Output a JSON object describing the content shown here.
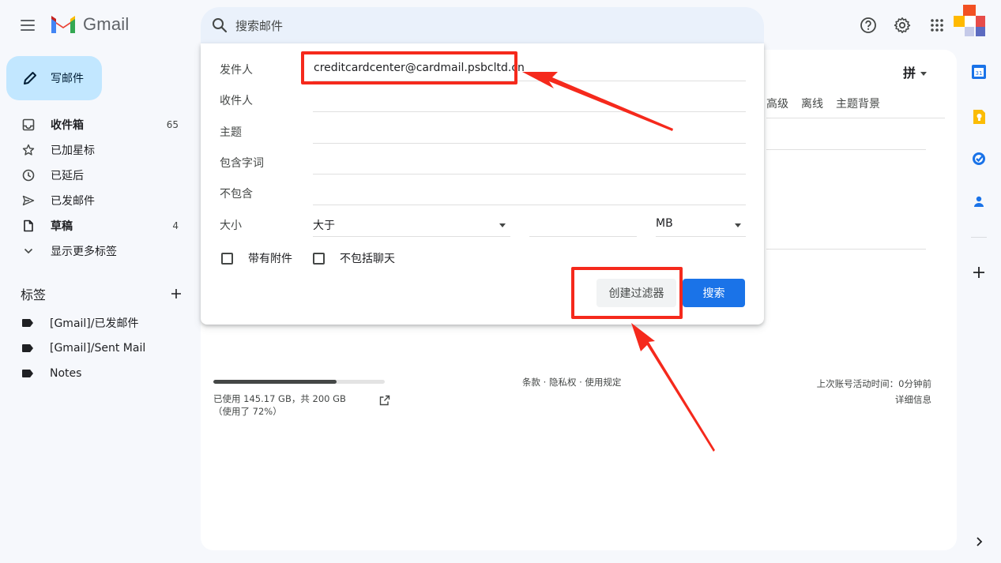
{
  "app": {
    "name": "Gmail",
    "search_placeholder": "搜索邮件"
  },
  "compose": {
    "label": "写邮件"
  },
  "nav": [
    {
      "name": "inbox",
      "label": "收件箱",
      "count": "65",
      "bold": true,
      "icon": "inbox-icon"
    },
    {
      "name": "starred",
      "label": "已加星标",
      "count": "",
      "bold": false,
      "icon": "star-icon"
    },
    {
      "name": "snoozed",
      "label": "已延后",
      "count": "",
      "bold": false,
      "icon": "clock-icon"
    },
    {
      "name": "sent",
      "label": "已发邮件",
      "count": "",
      "bold": false,
      "icon": "send-icon"
    },
    {
      "name": "drafts",
      "label": "草稿",
      "count": "4",
      "bold": true,
      "icon": "file-icon"
    },
    {
      "name": "more",
      "label": "显示更多标签",
      "count": "",
      "bold": false,
      "icon": "chevron-down-icon"
    }
  ],
  "labels": {
    "title": "标签",
    "items": [
      "[Gmail]/已发邮件",
      "[Gmail]/Sent Mail",
      "Notes"
    ]
  },
  "search_options": {
    "from_label": "发件人",
    "from_value": "creditcardcenter@cardmail.psbcltd.cn",
    "to_label": "收件人",
    "to_value": "",
    "subject_label": "主题",
    "subject_value": "",
    "has_words_label": "包含字词",
    "has_words_value": "",
    "no_words_label": "不包含",
    "no_words_value": "",
    "size_label": "大小",
    "size_operator": "大于",
    "size_value": "",
    "size_unit": "MB",
    "has_attachment_label": "带有附件",
    "exclude_chats_label": "不包括聊天",
    "create_filter_label": "创建过滤器",
    "search_label": "搜索"
  },
  "main": {
    "lang_label": "拼",
    "settings_links": [
      "高级",
      "离线",
      "主题背景"
    ],
    "storage": {
      "used_fraction": 0.72,
      "text": "已使用 145.17 GB，共 200 GB（使用了 72%）"
    },
    "footer_links": "条款 · 隐私权 · 使用规定",
    "last_activity": "上次账号活动时间：0分钟前",
    "details": "详细信息"
  },
  "colors": {
    "accent": "#1a73e8",
    "highlight": "#f5291c",
    "compose_bg": "#c2e7ff",
    "page_bg": "#f6f8fc"
  }
}
